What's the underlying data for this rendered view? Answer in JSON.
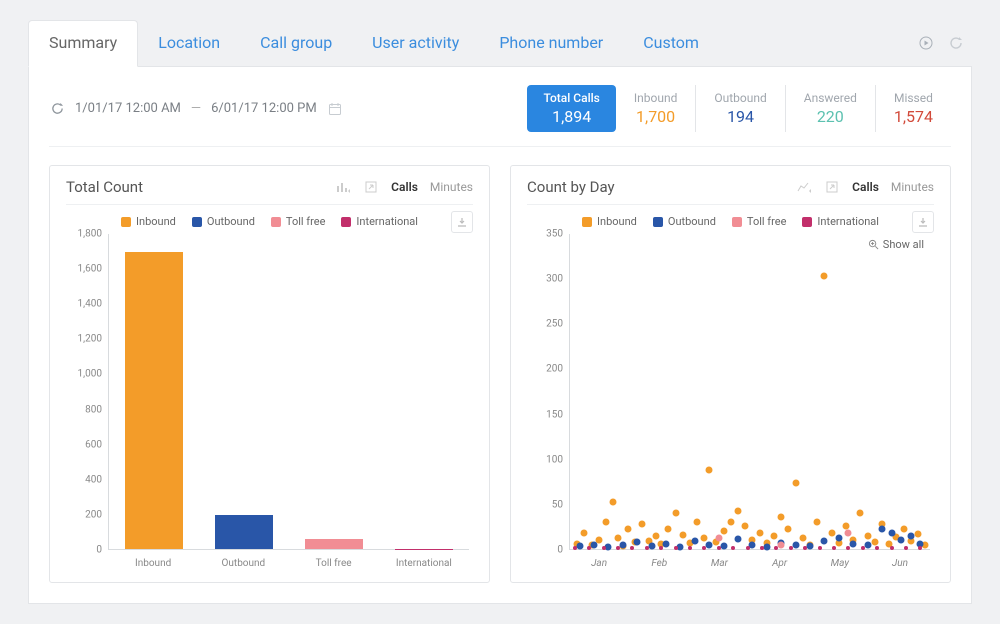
{
  "tabs": [
    "Summary",
    "Location",
    "Call group",
    "User activity",
    "Phone number",
    "Custom"
  ],
  "activeTab": 0,
  "dateRange": {
    "from": "1/01/17  12:00 AM",
    "to": "6/01/17  12:00 PM"
  },
  "metrics": {
    "total": {
      "label": "Total Calls",
      "value": "1,894"
    },
    "inbound": {
      "label": "Inbound",
      "value": "1,700"
    },
    "outbound": {
      "label": "Outbound",
      "value": "194"
    },
    "answered": {
      "label": "Answered",
      "value": "220"
    },
    "missed": {
      "label": "Missed",
      "value": "1,574"
    }
  },
  "series_colors": {
    "Inbound": "#f39c29",
    "Outbound": "#2956a8",
    "Toll free": "#f18d94",
    "International": "#c22f6b"
  },
  "legend_items": [
    "Inbound",
    "Outbound",
    "Toll free",
    "International"
  ],
  "panel_left": {
    "title": "Total Count",
    "modes": [
      "Calls",
      "Minutes"
    ],
    "activeMode": 0
  },
  "panel_right": {
    "title": "Count by Day",
    "modes": [
      "Calls",
      "Minutes"
    ],
    "activeMode": 0,
    "showAll": "Show all"
  },
  "chart_data": [
    {
      "id": "total_count",
      "type": "bar",
      "title": "Total Count",
      "ylabel": "",
      "ylim": [
        0,
        1800
      ],
      "y_ticks": [
        0,
        200,
        400,
        600,
        800,
        1000,
        1200,
        1400,
        1600,
        1800
      ],
      "categories": [
        "Inbound",
        "Outbound",
        "Toll free",
        "International"
      ],
      "values": [
        1700,
        194,
        60,
        2
      ],
      "colors": [
        "#f39c29",
        "#2956a8",
        "#f18d94",
        "#c22f6b"
      ]
    },
    {
      "id": "count_by_day",
      "type": "scatter",
      "title": "Count by Day",
      "ylabel": "",
      "ylim": [
        0,
        350
      ],
      "y_ticks": [
        0,
        50,
        100,
        150,
        200,
        250,
        300,
        350
      ],
      "x_range": [
        0,
        150
      ],
      "x_tick_labels": [
        "Jan",
        "Feb",
        "Mar",
        "Apr",
        "May",
        "Jun"
      ],
      "series": [
        {
          "name": "Inbound",
          "color": "#f39c29",
          "points": [
            [
              3,
              6
            ],
            [
              6,
              18
            ],
            [
              9,
              4
            ],
            [
              12,
              10
            ],
            [
              15,
              30
            ],
            [
              18,
              52
            ],
            [
              20,
              12
            ],
            [
              22,
              3
            ],
            [
              24,
              22
            ],
            [
              27,
              8
            ],
            [
              30,
              28
            ],
            [
              33,
              9
            ],
            [
              36,
              14
            ],
            [
              38,
              6
            ],
            [
              41,
              22
            ],
            [
              44,
              40
            ],
            [
              47,
              16
            ],
            [
              50,
              7
            ],
            [
              53,
              30
            ],
            [
              56,
              12
            ],
            [
              58,
              88
            ],
            [
              61,
              8
            ],
            [
              64,
              20
            ],
            [
              67,
              30
            ],
            [
              70,
              42
            ],
            [
              73,
              26
            ],
            [
              76,
              10
            ],
            [
              79,
              18
            ],
            [
              82,
              7
            ],
            [
              85,
              14
            ],
            [
              88,
              36
            ],
            [
              91,
              22
            ],
            [
              94,
              73
            ],
            [
              97,
              12
            ],
            [
              100,
              5
            ],
            [
              103,
              30
            ],
            [
              106,
              303
            ],
            [
              109,
              18
            ],
            [
              112,
              7
            ],
            [
              115,
              26
            ],
            [
              118,
              10
            ],
            [
              121,
              40
            ],
            [
              124,
              14
            ],
            [
              127,
              8
            ],
            [
              130,
              28
            ],
            [
              133,
              6
            ],
            [
              136,
              13
            ],
            [
              139,
              22
            ],
            [
              142,
              9
            ],
            [
              145,
              17
            ],
            [
              148,
              5
            ]
          ]
        },
        {
          "name": "Outbound",
          "color": "#2956a8",
          "points": [
            [
              4,
              3
            ],
            [
              10,
              5
            ],
            [
              16,
              2
            ],
            [
              22,
              4
            ],
            [
              28,
              8
            ],
            [
              34,
              3
            ],
            [
              40,
              6
            ],
            [
              46,
              2
            ],
            [
              52,
              9
            ],
            [
              58,
              4
            ],
            [
              64,
              3
            ],
            [
              70,
              11
            ],
            [
              76,
              5
            ],
            [
              82,
              2
            ],
            [
              88,
              7
            ],
            [
              94,
              4
            ],
            [
              100,
              3
            ],
            [
              106,
              9
            ],
            [
              112,
              12
            ],
            [
              118,
              6
            ],
            [
              124,
              4
            ],
            [
              130,
              22
            ],
            [
              134,
              18
            ],
            [
              138,
              10
            ],
            [
              142,
              14
            ],
            [
              146,
              6
            ]
          ]
        },
        {
          "name": "Toll free",
          "color": "#f18d94",
          "points": [
            [
              62,
              12
            ],
            [
              88,
              5
            ],
            [
              116,
              18
            ]
          ]
        },
        {
          "name": "International",
          "color": "#c22f6b",
          "points": [
            [
              2,
              1
            ],
            [
              8,
              1
            ],
            [
              14,
              1
            ],
            [
              20,
              1
            ],
            [
              26,
              1
            ],
            [
              32,
              1
            ],
            [
              38,
              1
            ],
            [
              44,
              1
            ],
            [
              50,
              1
            ],
            [
              56,
              1
            ],
            [
              62,
              1
            ],
            [
              68,
              1
            ],
            [
              74,
              1
            ],
            [
              80,
              1
            ],
            [
              86,
              1
            ],
            [
              92,
              1
            ],
            [
              98,
              1
            ],
            [
              104,
              1
            ],
            [
              110,
              1
            ],
            [
              116,
              1
            ],
            [
              122,
              1
            ],
            [
              128,
              1
            ],
            [
              134,
              1
            ],
            [
              140,
              1
            ],
            [
              146,
              1
            ]
          ]
        }
      ]
    }
  ]
}
